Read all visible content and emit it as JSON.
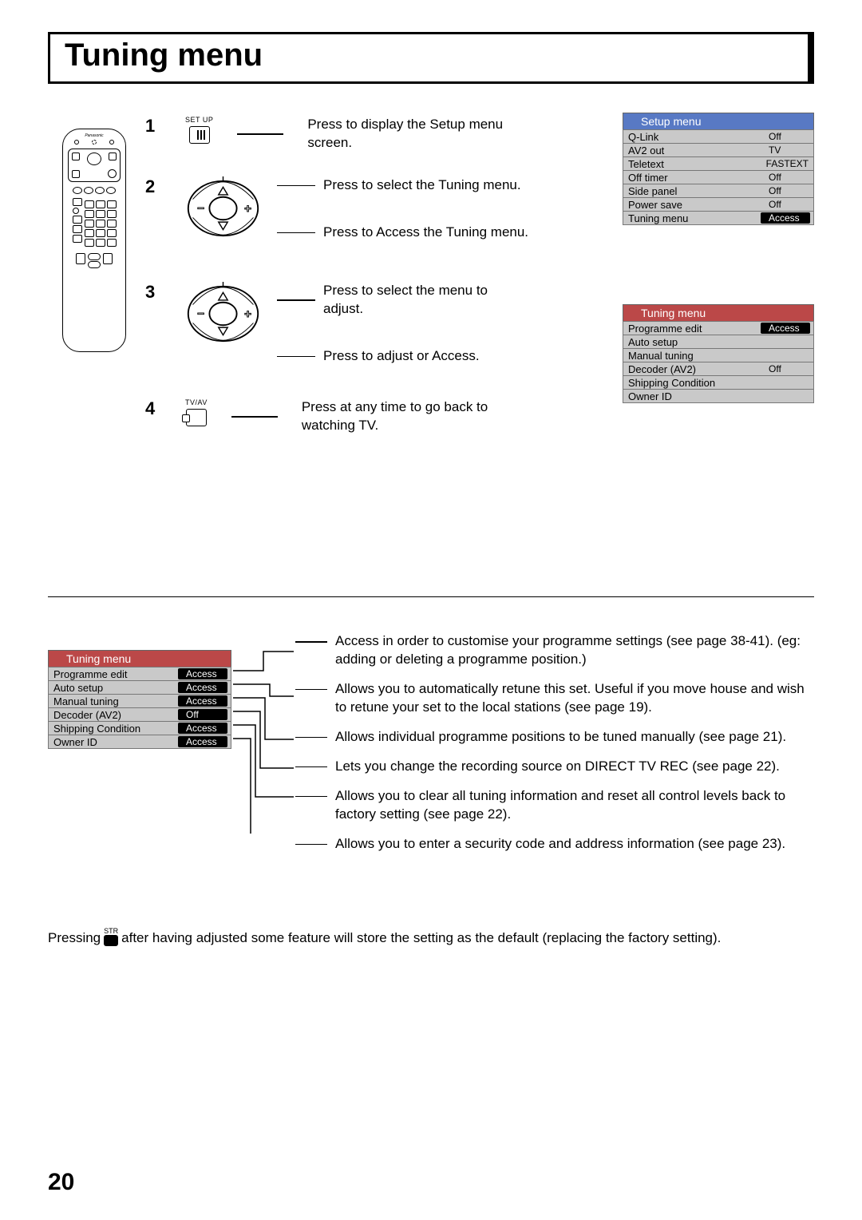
{
  "title": "Tuning menu",
  "page_number": "20",
  "steps": [
    {
      "num": "1",
      "icon_label": "SET UP",
      "text": "Press to display the Setup menu screen."
    },
    {
      "num": "2",
      "icon_label": "",
      "text_a": "Press to select the Tuning menu.",
      "text_b": "Press to Access the Tuning menu."
    },
    {
      "num": "3",
      "icon_label": "",
      "text_a": "Press to select the menu to adjust.",
      "text_b": "Press to adjust or Access."
    },
    {
      "num": "4",
      "icon_label": "TV/AV",
      "text": "Press  at any time to go back to watching TV."
    }
  ],
  "setup_menu": {
    "title": "Setup menu",
    "rows": [
      {
        "label": "Q-Link",
        "value": "Off"
      },
      {
        "label": "AV2 out",
        "value": "TV"
      },
      {
        "label": "Teletext",
        "value": "FASTEXT"
      },
      {
        "label": "Off timer",
        "value": "Off"
      },
      {
        "label": "Side panel",
        "value": "Off"
      },
      {
        "label": "Power save",
        "value": "Off"
      },
      {
        "label": "Tuning menu",
        "value": "Access",
        "highlight": true
      }
    ]
  },
  "tuning_menu": {
    "title": "Tuning menu",
    "rows": [
      {
        "label": "Programme edit",
        "value": "Access",
        "highlight": true
      },
      {
        "label": "Auto setup",
        "value": ""
      },
      {
        "label": "Manual tuning",
        "value": ""
      },
      {
        "label": "Decoder (AV2)",
        "value": "Off"
      },
      {
        "label": "Shipping Condition",
        "value": ""
      },
      {
        "label": "Owner ID",
        "value": ""
      }
    ]
  },
  "tuning_menu_full": {
    "title": "Tuning menu",
    "rows": [
      {
        "label": "Programme edit",
        "value": "Access",
        "highlight": true
      },
      {
        "label": "Auto setup",
        "value": "Access",
        "highlight": true
      },
      {
        "label": "Manual tuning",
        "value": "Access",
        "highlight": true
      },
      {
        "label": "Decoder (AV2)",
        "value": "Off",
        "highlight": true
      },
      {
        "label": "Shipping Condition",
        "value": "Access",
        "highlight": true
      },
      {
        "label": "Owner ID",
        "value": "Access",
        "highlight": true
      }
    ]
  },
  "descriptions": [
    "Access in order to customise your programme settings (see page 38-41). (eg: adding or deleting a programme position.)",
    "Allows you to automatically retune this set. Useful if you move house and wish to retune your set to the local stations (see page 19).",
    "Allows individual programme positions to be tuned manually (see page 21).",
    "Lets you change the recording source on DIRECT TV REC (see page 22).",
    "Allows you to clear all tuning information and reset all control levels back to factory setting (see page 22).",
    "Allows you to enter a security code and address information (see page 23)."
  ],
  "footer": {
    "prefix": "Pressing",
    "str_label": "STR",
    "suffix": "after having adjusted some feature will store the setting as the  default (replacing the factory setting)."
  },
  "remote_brand": "Panasonic"
}
